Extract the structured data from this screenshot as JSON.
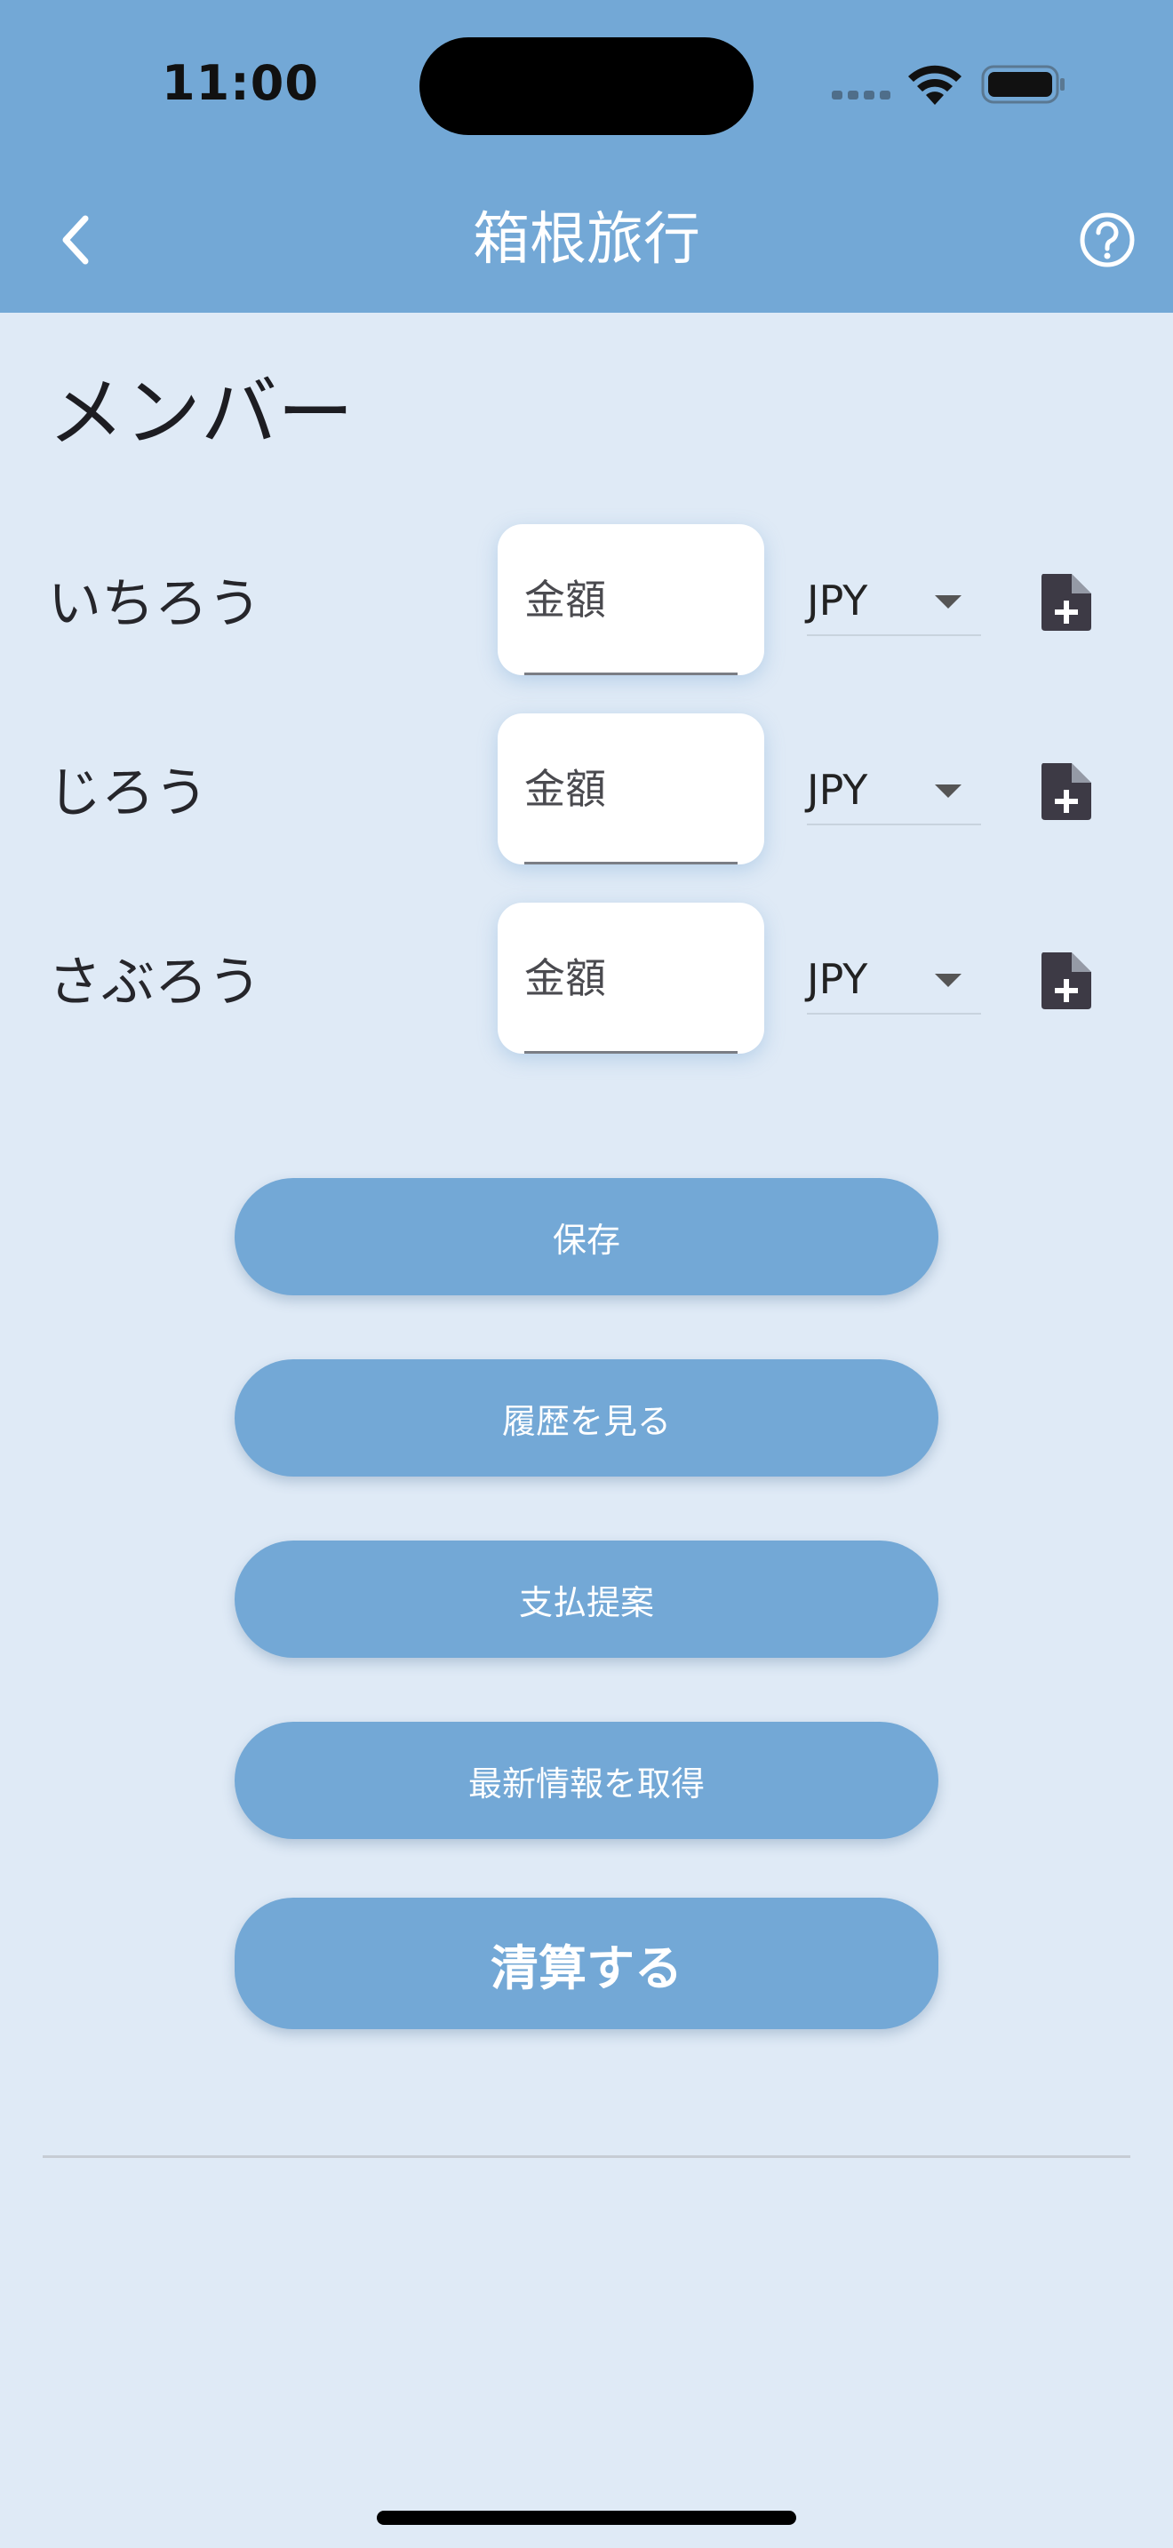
{
  "status_bar": {
    "time": "11:00"
  },
  "nav": {
    "title": "箱根旅行",
    "back_icon": "chevron-left-icon",
    "help_icon": "question-circle-icon"
  },
  "section": {
    "title": "メンバー"
  },
  "members": [
    {
      "name": "いちろう",
      "amount_placeholder": "金額",
      "amount_value": "",
      "currency": "JPY"
    },
    {
      "name": "じろう",
      "amount_placeholder": "金額",
      "amount_value": "",
      "currency": "JPY"
    },
    {
      "name": "さぶろう",
      "amount_placeholder": "金額",
      "amount_value": "",
      "currency": "JPY"
    }
  ],
  "actions": {
    "save": "保存",
    "history": "履歴を見る",
    "payment_proposal": "支払提案",
    "fetch_latest": "最新情報を取得",
    "settle": "清算する"
  },
  "colors": {
    "header_bg": "#73a8d6",
    "page_bg": "#dfeaf6",
    "button_bg": "#73a8d6",
    "button_text": "#ffffff",
    "icon_dark": "#3d3a45"
  }
}
